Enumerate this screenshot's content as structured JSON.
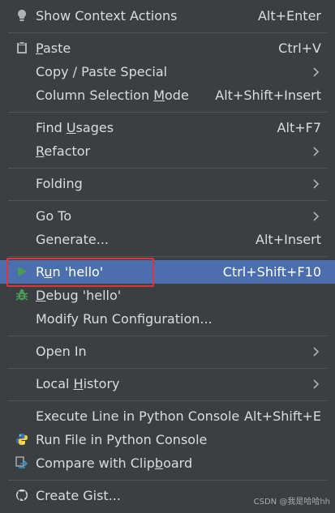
{
  "menu": {
    "items": [
      {
        "icon": "lightbulb-icon",
        "label": "Show Context Actions",
        "shortcut": "Alt+Enter"
      },
      {
        "icon": "clipboard-icon",
        "label_pre": "",
        "label_ul": "P",
        "label_post": "aste",
        "shortcut": "Ctrl+V"
      },
      {
        "label": "Copy / Paste Special",
        "submenu": true
      },
      {
        "label_pre": "Column Selection ",
        "label_ul": "M",
        "label_post": "ode",
        "shortcut": "Alt+Shift+Insert"
      },
      {
        "label_pre": "Find ",
        "label_ul": "U",
        "label_post": "sages",
        "shortcut": "Alt+F7"
      },
      {
        "label_pre": "",
        "label_ul": "R",
        "label_post": "efactor",
        "submenu": true
      },
      {
        "label": "Folding",
        "submenu": true
      },
      {
        "label": "Go To",
        "submenu": true
      },
      {
        "label": "Generate...",
        "shortcut": "Alt+Insert"
      },
      {
        "icon": "run-icon",
        "label_pre": "R",
        "label_ul": "u",
        "label_post": "n 'hello'",
        "shortcut": "Ctrl+Shift+F10",
        "selected": true
      },
      {
        "icon": "debug-icon",
        "label_pre": "",
        "label_ul": "D",
        "label_post": "ebug 'hello'"
      },
      {
        "label": "Modify Run Configuration..."
      },
      {
        "label": "Open In",
        "submenu": true
      },
      {
        "label_pre": "Local ",
        "label_ul": "H",
        "label_post": "istory",
        "submenu": true
      },
      {
        "label": "Execute Line in Python Console",
        "shortcut": "Alt+Shift+E"
      },
      {
        "icon": "python-icon",
        "label": "Run File in Python Console"
      },
      {
        "icon": "compare-icon",
        "label_pre": "Compare with Clip",
        "label_ul": "b",
        "label_post": "oard"
      },
      {
        "icon": "github-icon",
        "label": "Create Gist..."
      }
    ]
  },
  "watermark": "CSDN @我是哈哈hh",
  "colors": {
    "background": "#3c3f41",
    "selection": "#4b6eaf",
    "highlight_box": "#e0343a",
    "run_green": "#499c54"
  }
}
